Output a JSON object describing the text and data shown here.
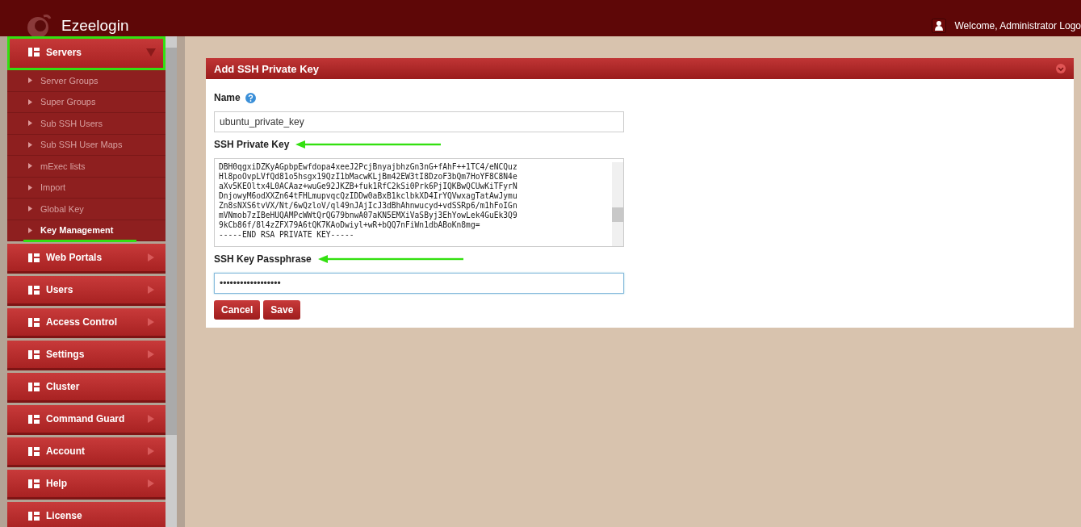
{
  "header": {
    "brand": "Ezeelogin",
    "welcome": "Welcome, Administrator Logo"
  },
  "sidebar": {
    "items": [
      {
        "label": "Servers",
        "submenu": true,
        "highlighted": true,
        "children": [
          {
            "label": "Server Groups",
            "selected": false
          },
          {
            "label": "Super Groups",
            "selected": false
          },
          {
            "label": "Sub SSH Users",
            "selected": false
          },
          {
            "label": "Sub SSH User Maps",
            "selected": false
          },
          {
            "label": "mExec lists",
            "selected": false
          },
          {
            "label": "Import",
            "selected": false
          },
          {
            "label": "Global Key",
            "selected": false
          },
          {
            "label": "Key Management",
            "selected": true
          }
        ]
      },
      {
        "label": "Web Portals",
        "submenu": true,
        "highlighted": false
      },
      {
        "label": "Users",
        "submenu": true,
        "highlighted": false
      },
      {
        "label": "Access Control",
        "submenu": true,
        "highlighted": false
      },
      {
        "label": "Settings",
        "submenu": true,
        "highlighted": false
      },
      {
        "label": "Cluster",
        "submenu": false,
        "highlighted": false
      },
      {
        "label": "Command Guard",
        "submenu": true,
        "highlighted": false
      },
      {
        "label": "Account",
        "submenu": true,
        "highlighted": false
      },
      {
        "label": "Help",
        "submenu": true,
        "highlighted": false
      },
      {
        "label": "License",
        "submenu": false,
        "highlighted": false
      }
    ]
  },
  "panel": {
    "title": "Add SSH Private Key",
    "fields": [
      {
        "kind": "text",
        "label": "Name",
        "help": true,
        "annotated": false,
        "value": "ubuntu_private_key"
      },
      {
        "kind": "textarea",
        "label": "SSH Private Key",
        "help": false,
        "annotated": true,
        "lines": [
          "DBH0qgxiDZKyAGpbpEwfdopa4xeeJ2PcjBnyajbhzGn3nG+fAhF++1TC4/eNCQuz",
          "Hl8poOvpLVfQd81o5hsgx19QzI1bMacwKLjBm42EW3tI8DzoF3bQm7HoYF8C8N4e",
          "aXv5KEOltx4L0ACAaz+wuGe92JKZB+fuk1RfC2kSi0Prk6PjIQKBwQCUwKiTFyrN",
          "DnjowyM6odXXZn64tFHLmupvqcQzIDDw0aBxB1kclbkXD4IrYQVwxagTatAwJymu",
          "Zn8sNXS6tvVX/Nt/6wQzloV/ql49nJAjIcJ3dBhAhnwucyd+vdSSRp6/m1hFoIGn",
          "mVNmob7zIBeHUQAMPcWWtQrQG79bnwA07aKN5EMXiVaSByj3EhYowLek4GuEk3Q9",
          "9kCb86f/8l4zZFX79A6tQK7KAoDwiyl+wR+bQQ7nFiWn1dbABoKn8mg=",
          "-----END RSA PRIVATE KEY-----"
        ]
      },
      {
        "kind": "password",
        "label": "SSH Key Passphrase",
        "help": false,
        "annotated": true,
        "value": "••••••••••••••••••"
      }
    ],
    "buttons": [
      "Cancel",
      "Save"
    ]
  }
}
